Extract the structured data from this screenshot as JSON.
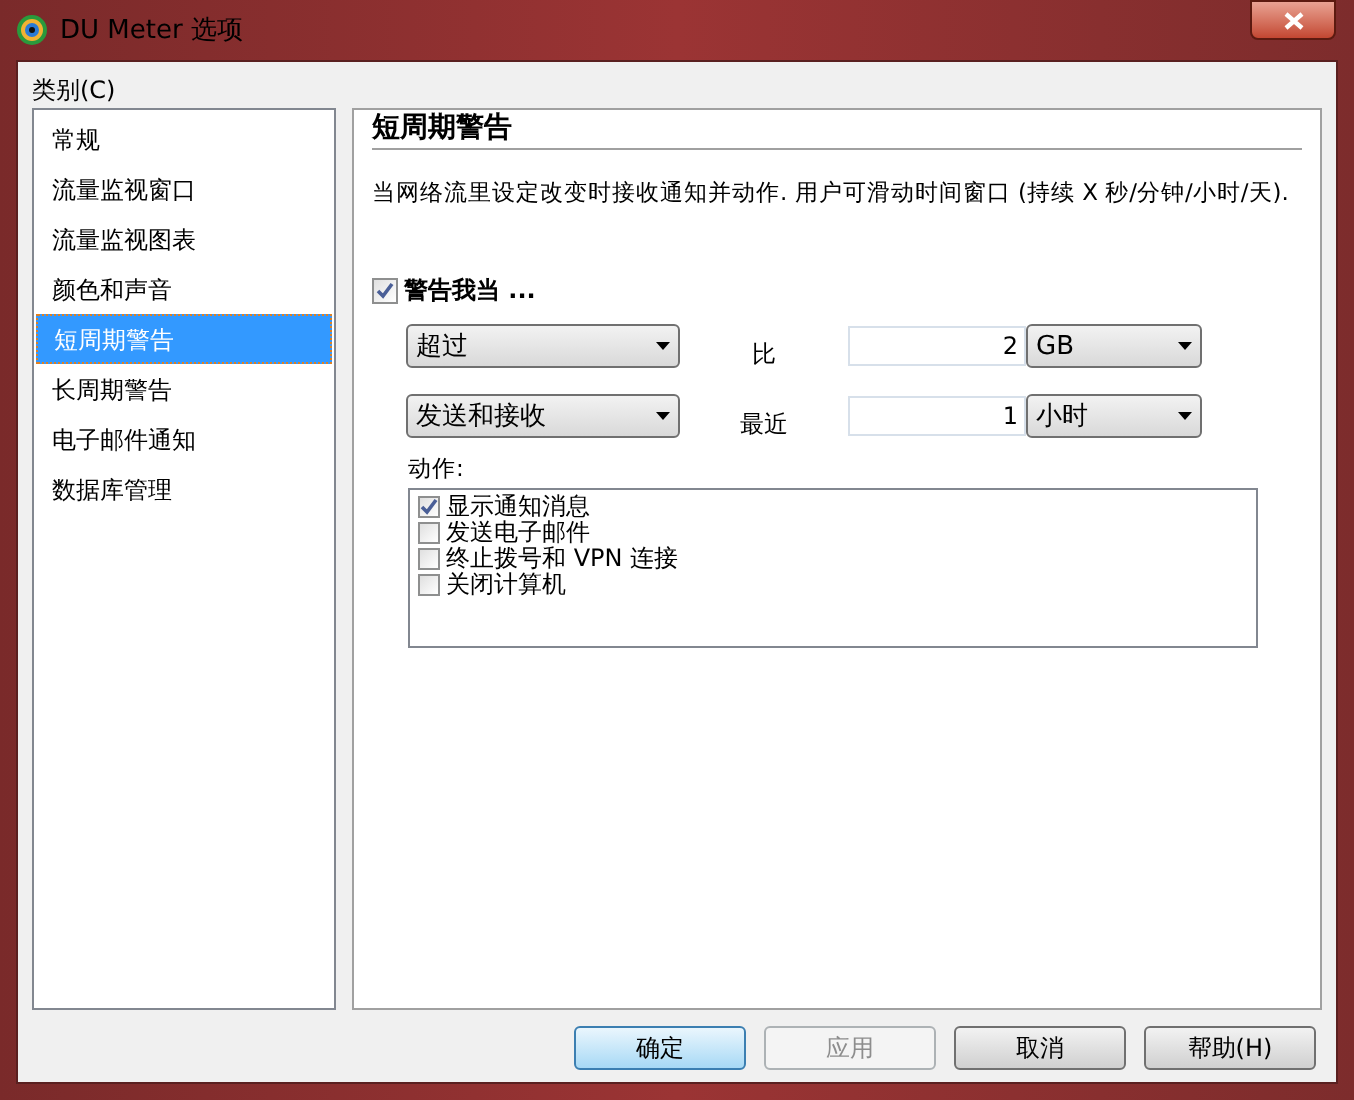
{
  "window": {
    "title": "DU Meter 选项"
  },
  "category_label": "类别(C)",
  "categories": [
    {
      "label": "常规",
      "selected": false
    },
    {
      "label": "流量监视窗口",
      "selected": false
    },
    {
      "label": "流量监视图表",
      "selected": false
    },
    {
      "label": "颜色和声音",
      "selected": false
    },
    {
      "label": "短周期警告",
      "selected": true
    },
    {
      "label": "长周期警告",
      "selected": false
    },
    {
      "label": "电子邮件通知",
      "selected": false
    },
    {
      "label": "数据库管理",
      "selected": false
    }
  ],
  "panel": {
    "title": "短周期警告",
    "description": "当网络流里设定改变时接收通知并动作. 用户可滑动时间窗口 (持续 X 秒/分钟/小时/天).",
    "warn": {
      "label": "警告我当 ...",
      "checked": true
    },
    "rows": [
      {
        "condition": "超过",
        "middle": "比",
        "amount": "2",
        "unit": "GB"
      },
      {
        "condition": "发送和接收",
        "middle": "最近",
        "amount": "1",
        "unit": "小时"
      }
    ],
    "actions_label": "动作:",
    "actions": [
      {
        "label": "显示通知消息",
        "checked": true
      },
      {
        "label": "发送电子邮件",
        "checked": false
      },
      {
        "label": "终止拨号和 VPN 连接",
        "checked": false
      },
      {
        "label": "关闭计算机",
        "checked": false
      }
    ]
  },
  "buttons": [
    {
      "label": "确定",
      "kind": "default",
      "disabled": false
    },
    {
      "label": "应用",
      "kind": "normal",
      "disabled": true
    },
    {
      "label": "取消",
      "kind": "normal",
      "disabled": false
    },
    {
      "label": "帮助(H)",
      "kind": "normal",
      "disabled": false
    }
  ]
}
